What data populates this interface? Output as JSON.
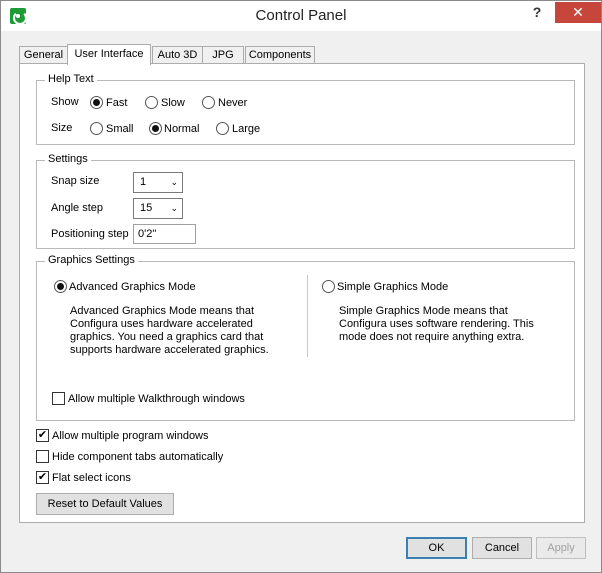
{
  "window": {
    "title": "Control Panel",
    "help_glyph": "?",
    "close_glyph": "✕"
  },
  "tabs": [
    "General",
    "User Interface",
    "Auto 3D",
    "JPG",
    "Components"
  ],
  "active_tab": "User Interface",
  "help_text": {
    "legend": "Help Text",
    "show_label": "Show",
    "show_options": [
      "Fast",
      "Slow",
      "Never"
    ],
    "show_selected": "Fast",
    "size_label": "Size",
    "size_options": [
      "Small",
      "Normal",
      "Large"
    ],
    "size_selected": "Normal"
  },
  "settings": {
    "legend": "Settings",
    "snap_label": "Snap size",
    "snap_value": "1",
    "angle_label": "Angle step",
    "angle_value": "15",
    "positioning_label": "Positioning step",
    "positioning_value": "0'2\""
  },
  "graphics": {
    "legend": "Graphics Settings",
    "advanced_label": "Advanced Graphics Mode",
    "advanced_desc": [
      "Advanced Graphics Mode means that",
      "Configura uses hardware accelerated",
      "graphics. You need a graphics card that",
      "supports hardware accelerated graphics."
    ],
    "simple_label": "Simple Graphics Mode",
    "simple_desc": [
      "Simple Graphics Mode means that",
      "Configura uses software rendering. This",
      "mode does not require anything extra."
    ],
    "selected": "Advanced Graphics Mode",
    "walkthrough_label": "Allow multiple Walkthrough windows",
    "walkthrough_checked": false
  },
  "options": {
    "multi_program_label": "Allow multiple program windows",
    "multi_program_checked": true,
    "hide_tabs_label": "Hide component tabs automatically",
    "hide_tabs_checked": false,
    "flat_icons_label": "Flat select icons",
    "flat_icons_checked": true
  },
  "reset_label": "Reset to Default Values",
  "footer": {
    "ok_label": "OK",
    "cancel_label": "Cancel",
    "apply_label": "Apply"
  },
  "check_glyph": "✔",
  "chevron_glyph": "⌄",
  "icons": {
    "app": "configura-logo-icon",
    "close": "close-icon",
    "help": "help-icon",
    "dropdown": "chevron-down-icon"
  },
  "colors": {
    "close_button": "#c7463c",
    "app_icon": "#1e9a37",
    "default_button_border": "#3c7fb1"
  }
}
